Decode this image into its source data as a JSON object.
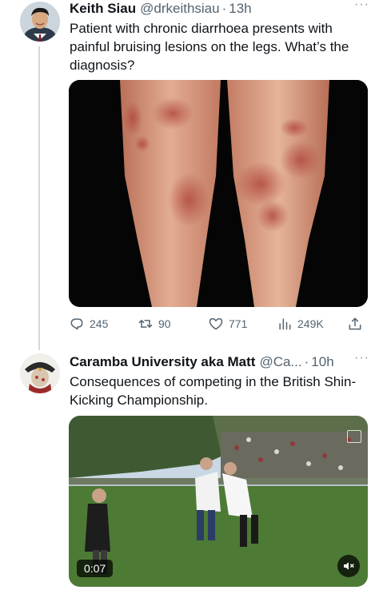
{
  "tweets": [
    {
      "author": {
        "name": "Keith Siau",
        "handle": "@drkeithsiau",
        "time": "13h"
      },
      "text": "Patient with chronic diarrhoea presents with painful bruising lesions on the legs. What’s the diagnosis?",
      "media": {
        "kind": "image"
      },
      "stats": {
        "replies": "245",
        "retweets": "90",
        "likes": "771",
        "views": "249K"
      }
    },
    {
      "author": {
        "name": "Caramba University aka Matt",
        "handle": "@Ca...",
        "time": "10h"
      },
      "text": "Consequences of competing in the British Shin-Kicking Championship.",
      "media": {
        "kind": "video",
        "duration": "0:07"
      }
    }
  ],
  "ui": {
    "more_glyph": "···",
    "dot": "·"
  },
  "colors": {
    "secondary_text": "#536471",
    "thread_line": "#cfd9de",
    "primary_text": "#0f1419"
  },
  "icons": [
    "reply-icon",
    "retweet-icon",
    "like-icon",
    "views-icon",
    "share-icon",
    "mute-icon"
  ]
}
